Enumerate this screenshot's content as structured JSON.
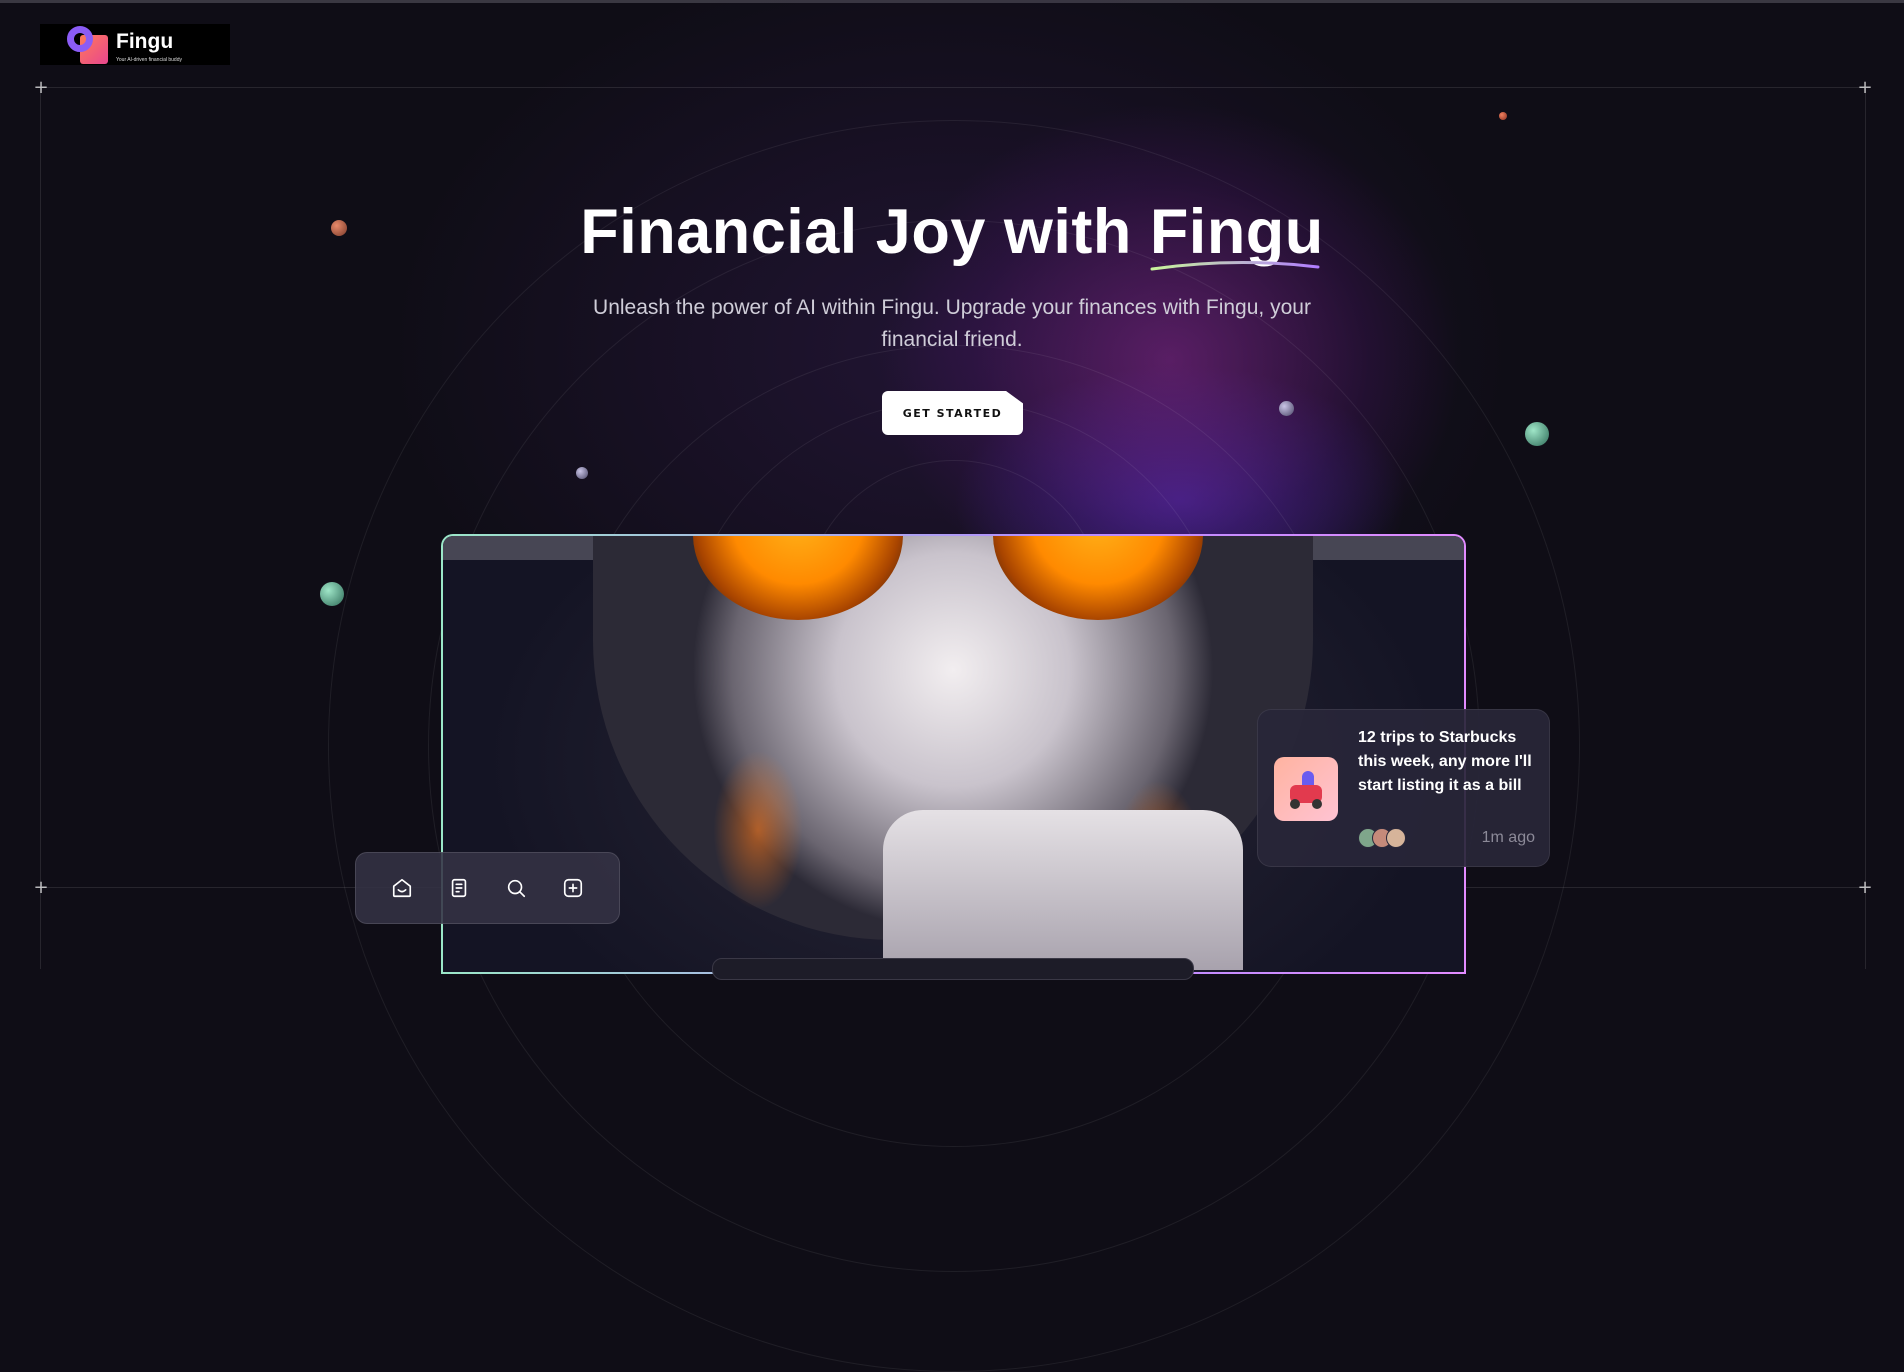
{
  "brand": {
    "name": "Fingu",
    "tagline": "Your AI-driven financial buddy"
  },
  "hero": {
    "title": "Financial Joy with Fingu",
    "subtitle": "Unleash the power of AI within Fingu. Upgrade your finances with Fingu, your financial friend.",
    "cta_label": "GET STARTED"
  },
  "notification": {
    "message": "12 trips to Starbucks this week, any more I'll start listing it as a bill",
    "time": "1m ago"
  },
  "dock": {
    "items": [
      {
        "icon": "home-icon"
      },
      {
        "icon": "document-icon"
      },
      {
        "icon": "search-icon"
      },
      {
        "icon": "add-icon"
      }
    ]
  },
  "colors": {
    "background": "#0f0d16",
    "accent_purple": "#8b5cf6",
    "accent_green": "#9be7c8",
    "cta_background": "#ffffff"
  }
}
